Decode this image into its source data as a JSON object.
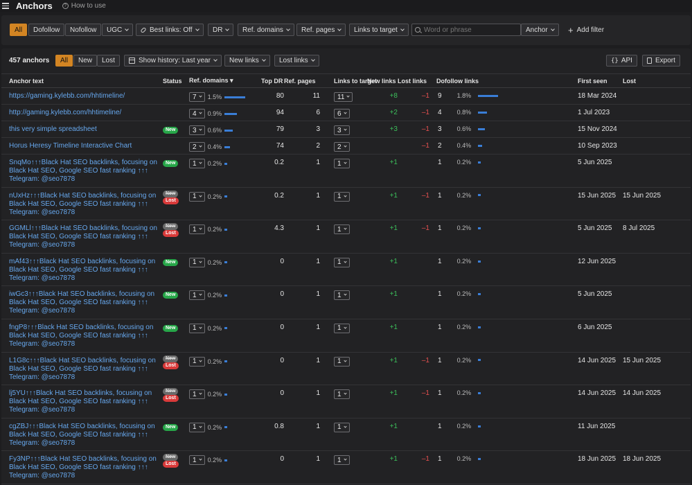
{
  "header": {
    "title": "Anchors",
    "how_to_use": "How to use"
  },
  "filters": {
    "segments": [
      "All",
      "Dofollow",
      "Nofollow",
      "UGC"
    ],
    "best_links": "Best links: Off",
    "dr": "DR",
    "ref_domains": "Ref. domains",
    "ref_pages": "Ref. pages",
    "links_to_target": "Links to target",
    "search_placeholder": "Word or phrase",
    "anchor_dropdown": "Anchor",
    "add_filter": "Add filter"
  },
  "toolbar": {
    "count": "457 anchors",
    "tabs": [
      "All",
      "New",
      "Lost"
    ],
    "history": "Show history: Last year",
    "new_links": "New links",
    "lost_links": "Lost links",
    "api": "API",
    "api_glyph": "{}",
    "export": "Export"
  },
  "table": {
    "headers": {
      "anchor": "Anchor text",
      "status": "Status",
      "ref_domains": "Ref. domains ▾",
      "top_dr": "Top DR",
      "ref_pages": "Ref. pages",
      "links_to_target": "Links to target",
      "new_links": "New links",
      "lost_links": "Lost links",
      "dofollow": "Dofollow links",
      "first_seen": "First seen",
      "lost": "Lost"
    },
    "rows": [
      {
        "anchor": "https://gaming.kylebb.com/hhtimeline/",
        "status": "",
        "rd": "7",
        "rd_pct": "1.5%",
        "rd_share": 1.5,
        "dr": "80",
        "pages": "11",
        "ltt": "11",
        "newl": "+8",
        "lostl": "–1",
        "dof": "9",
        "dof_pct": "1.8%",
        "dof_share": 1.8,
        "first": "18 Mar 2024",
        "lost": ""
      },
      {
        "anchor": "http://gaming.kylebb.com/hhtimeline/",
        "status": "",
        "rd": "4",
        "rd_pct": "0.9%",
        "rd_share": 0.9,
        "dr": "94",
        "pages": "6",
        "ltt": "6",
        "newl": "+2",
        "lostl": "–1",
        "dof": "4",
        "dof_pct": "0.8%",
        "dof_share": 0.8,
        "first": "1 Jul 2023",
        "lost": ""
      },
      {
        "anchor": "this very simple spreadsheet",
        "status": "new",
        "rd": "3",
        "rd_pct": "0.6%",
        "rd_share": 0.6,
        "dr": "79",
        "pages": "3",
        "ltt": "3",
        "newl": "+3",
        "lostl": "–1",
        "dof": "3",
        "dof_pct": "0.6%",
        "dof_share": 0.6,
        "first": "15 Nov 2024",
        "lost": ""
      },
      {
        "anchor": "Horus Heresy Timeline Interactive Chart",
        "status": "",
        "rd": "2",
        "rd_pct": "0.4%",
        "rd_share": 0.4,
        "dr": "74",
        "pages": "2",
        "ltt": "2",
        "newl": "",
        "lostl": "–1",
        "dof": "2",
        "dof_pct": "0.4%",
        "dof_share": 0.4,
        "first": "10 Sep 2023",
        "lost": ""
      },
      {
        "anchor": "SnqMo↑↑↑Black Hat SEO backlinks, focusing on Black Hat SEO, Google SEO fast ranking ↑↑↑ Telegram: @seo7878",
        "status": "new",
        "rd": "1",
        "rd_pct": "0.2%",
        "rd_share": 0.2,
        "dr": "0.2",
        "pages": "1",
        "ltt": "1",
        "newl": "+1",
        "lostl": "",
        "dof": "1",
        "dof_pct": "0.2%",
        "dof_share": 0.2,
        "first": "5 Jun 2025",
        "lost": ""
      },
      {
        "anchor": "nUxHz↑↑↑Black Hat SEO backlinks, focusing on Black Hat SEO, Google SEO fast ranking ↑↑↑ Telegram: @seo7878",
        "status": "newlost",
        "rd": "1",
        "rd_pct": "0.2%",
        "rd_share": 0.2,
        "dr": "0.2",
        "pages": "1",
        "ltt": "1",
        "newl": "+1",
        "lostl": "–1",
        "dof": "1",
        "dof_pct": "0.2%",
        "dof_share": 0.2,
        "first": "15 Jun 2025",
        "lost": "15 Jun 2025"
      },
      {
        "anchor": "GGMLl↑↑↑Black Hat SEO backlinks, focusing on Black Hat SEO, Google SEO fast ranking ↑↑↑ Telegram: @seo7878",
        "status": "newlost",
        "rd": "1",
        "rd_pct": "0.2%",
        "rd_share": 0.2,
        "dr": "4.3",
        "pages": "1",
        "ltt": "1",
        "newl": "+1",
        "lostl": "–1",
        "dof": "1",
        "dof_pct": "0.2%",
        "dof_share": 0.2,
        "first": "5 Jun 2025",
        "lost": "8 Jul 2025"
      },
      {
        "anchor": "mAf43↑↑↑Black Hat SEO backlinks, focusing on Black Hat SEO, Google SEO fast ranking ↑↑↑ Telegram: @seo7878",
        "status": "new",
        "rd": "1",
        "rd_pct": "0.2%",
        "rd_share": 0.2,
        "dr": "0",
        "pages": "1",
        "ltt": "1",
        "newl": "+1",
        "lostl": "",
        "dof": "1",
        "dof_pct": "0.2%",
        "dof_share": 0.2,
        "first": "12 Jun 2025",
        "lost": ""
      },
      {
        "anchor": "iwGc3↑↑↑Black Hat SEO backlinks, focusing on Black Hat SEO, Google SEO fast ranking ↑↑↑ Telegram: @seo7878",
        "status": "new",
        "rd": "1",
        "rd_pct": "0.2%",
        "rd_share": 0.2,
        "dr": "0",
        "pages": "1",
        "ltt": "1",
        "newl": "+1",
        "lostl": "",
        "dof": "1",
        "dof_pct": "0.2%",
        "dof_share": 0.2,
        "first": "5 Jun 2025",
        "lost": ""
      },
      {
        "anchor": "fngP8↑↑↑Black Hat SEO backlinks, focusing on Black Hat SEO, Google SEO fast ranking ↑↑↑ Telegram: @seo7878",
        "status": "new",
        "rd": "1",
        "rd_pct": "0.2%",
        "rd_share": 0.2,
        "dr": "0",
        "pages": "1",
        "ltt": "1",
        "newl": "+1",
        "lostl": "",
        "dof": "1",
        "dof_pct": "0.2%",
        "dof_share": 0.2,
        "first": "6 Jun 2025",
        "lost": ""
      },
      {
        "anchor": "L1G8c↑↑↑Black Hat SEO backlinks, focusing on Black Hat SEO, Google SEO fast ranking ↑↑↑ Telegram: @seo7878",
        "status": "newlost",
        "rd": "1",
        "rd_pct": "0.2%",
        "rd_share": 0.2,
        "dr": "0",
        "pages": "1",
        "ltt": "1",
        "newl": "+1",
        "lostl": "–1",
        "dof": "1",
        "dof_pct": "0.2%",
        "dof_share": 0.2,
        "first": "14 Jun 2025",
        "lost": "15 Jun 2025"
      },
      {
        "anchor": "lj5YU↑↑↑Black Hat SEO backlinks, focusing on Black Hat SEO, Google SEO fast ranking ↑↑↑ Telegram: @seo7878",
        "status": "newlost",
        "rd": "1",
        "rd_pct": "0.2%",
        "rd_share": 0.2,
        "dr": "0",
        "pages": "1",
        "ltt": "1",
        "newl": "+1",
        "lostl": "–1",
        "dof": "1",
        "dof_pct": "0.2%",
        "dof_share": 0.2,
        "first": "14 Jun 2025",
        "lost": "14 Jun 2025"
      },
      {
        "anchor": "cgZBJ↑↑↑Black Hat SEO backlinks, focusing on Black Hat SEO, Google SEO fast ranking ↑↑↑ Telegram: @seo7878",
        "status": "new",
        "rd": "1",
        "rd_pct": "0.2%",
        "rd_share": 0.2,
        "dr": "0.8",
        "pages": "1",
        "ltt": "1",
        "newl": "+1",
        "lostl": "",
        "dof": "1",
        "dof_pct": "0.2%",
        "dof_share": 0.2,
        "first": "11 Jun 2025",
        "lost": ""
      },
      {
        "anchor": "Fy3NP↑↑↑Black Hat SEO backlinks, focusing on Black Hat SEO, Google SEO fast ranking ↑↑↑ Telegram: @seo7878",
        "status": "newlost",
        "rd": "1",
        "rd_pct": "0.2%",
        "rd_share": 0.2,
        "dr": "0",
        "pages": "1",
        "ltt": "1",
        "newl": "+1",
        "lostl": "–1",
        "dof": "1",
        "dof_pct": "0.2%",
        "dof_share": 0.2,
        "first": "18 Jun 2025",
        "lost": "18 Jun 2025"
      }
    ]
  },
  "badges": {
    "new": "New",
    "lost": "Lost"
  },
  "colors": {
    "accent": "#d38523",
    "link": "#67a8ee",
    "positive": "#3cbf5b",
    "negative": "#e65050",
    "bar": "#3a7ed7"
  },
  "icons": {
    "menu": "hamburger-icon",
    "help": "question-circle-icon",
    "link": "link-icon",
    "search": "search-icon",
    "plus": "plus-icon",
    "calendar": "calendar-icon",
    "export": "export-icon",
    "chevron": "chevron-down-icon"
  }
}
